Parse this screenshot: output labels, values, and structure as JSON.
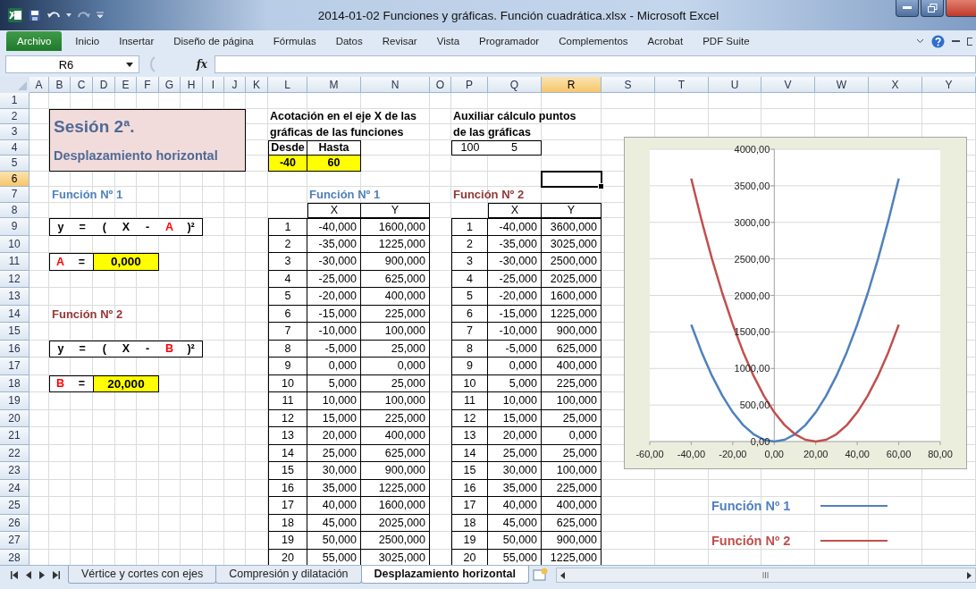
{
  "window": {
    "title": "2014-01-02 Funciones y gráficas. Función cuadrática.xlsx  -  Microsoft Excel"
  },
  "ribbon": {
    "tabs": [
      {
        "label": "Archivo",
        "kind": "file"
      },
      {
        "label": "Inicio",
        "kind": "tab"
      },
      {
        "label": "Insertar",
        "kind": "tab"
      },
      {
        "label": "Diseño de página",
        "kind": "tab"
      },
      {
        "label": "Fórmulas",
        "kind": "tab"
      },
      {
        "label": "Datos",
        "kind": "tab"
      },
      {
        "label": "Revisar",
        "kind": "tab"
      },
      {
        "label": "Vista",
        "kind": "tab"
      },
      {
        "label": "Programador",
        "kind": "tab"
      },
      {
        "label": "Complementos",
        "kind": "tab"
      },
      {
        "label": "Acrobat",
        "kind": "tab"
      },
      {
        "label": "PDF Suite",
        "kind": "tab"
      }
    ]
  },
  "formula_bar": {
    "name_box": "R6",
    "function_label": "fx"
  },
  "columns": [
    {
      "label": "A",
      "selected": false
    },
    {
      "label": "B",
      "selected": false
    },
    {
      "label": "C",
      "selected": false
    },
    {
      "label": "D",
      "selected": false
    },
    {
      "label": "E",
      "selected": false
    },
    {
      "label": "F",
      "selected": false
    },
    {
      "label": "G",
      "selected": false
    },
    {
      "label": "H",
      "selected": false
    },
    {
      "label": "I",
      "selected": false
    },
    {
      "label": "J",
      "selected": false
    },
    {
      "label": "K",
      "selected": false
    },
    {
      "label": "L",
      "selected": false
    },
    {
      "label": "M",
      "selected": false
    },
    {
      "label": "N",
      "selected": false
    },
    {
      "label": "O",
      "selected": false
    },
    {
      "label": "P",
      "selected": false
    },
    {
      "label": "Q",
      "selected": false
    },
    {
      "label": "R",
      "selected": true
    },
    {
      "label": "S",
      "selected": false
    },
    {
      "label": "T",
      "selected": false
    },
    {
      "label": "U",
      "selected": false
    },
    {
      "label": "V",
      "selected": false
    },
    {
      "label": "W",
      "selected": false
    },
    {
      "label": "X",
      "selected": false
    },
    {
      "label": "Y",
      "selected": false
    }
  ],
  "rows": [
    {
      "label": "1",
      "selected": false
    },
    {
      "label": "2",
      "selected": false
    },
    {
      "label": "3",
      "selected": false
    },
    {
      "label": "4",
      "selected": false
    },
    {
      "label": "5",
      "selected": false
    },
    {
      "label": "6",
      "selected": true
    },
    {
      "label": "7",
      "selected": false
    },
    {
      "label": "8",
      "selected": false
    },
    {
      "label": "9",
      "selected": false
    },
    {
      "label": "10",
      "selected": false
    },
    {
      "label": "11",
      "selected": false
    },
    {
      "label": "12",
      "selected": false
    },
    {
      "label": "13",
      "selected": false
    },
    {
      "label": "14",
      "selected": false
    },
    {
      "label": "15",
      "selected": false
    },
    {
      "label": "16",
      "selected": false
    },
    {
      "label": "17",
      "selected": false
    },
    {
      "label": "18",
      "selected": false
    },
    {
      "label": "19",
      "selected": false
    },
    {
      "label": "20",
      "selected": false
    },
    {
      "label": "21",
      "selected": false
    },
    {
      "label": "22",
      "selected": false
    },
    {
      "label": "23",
      "selected": false
    },
    {
      "label": "24",
      "selected": false
    },
    {
      "label": "25",
      "selected": false
    },
    {
      "label": "26",
      "selected": false
    },
    {
      "label": "27",
      "selected": false
    },
    {
      "label": "28",
      "selected": false
    }
  ],
  "sheet": {
    "title_box": {
      "title": "Sesión 2ª.",
      "subtitle": "Desplazamiento horizontal"
    },
    "functions": [
      {
        "heading": "Función Nº 1",
        "color": "#4f81bd",
        "formula": [
          {
            "text": "y",
            "kind": "symbol"
          },
          {
            "text": "=",
            "kind": "symbol"
          },
          {
            "text": "(",
            "kind": "symbol"
          },
          {
            "text": "X",
            "kind": "symbol"
          },
          {
            "text": "-",
            "kind": "symbol"
          },
          {
            "text": "A",
            "kind": "parameter"
          },
          {
            "text": ")²",
            "kind": "symbol"
          }
        ],
        "parameter": {
          "name": "A",
          "sign": "=",
          "value": "0,000"
        }
      },
      {
        "heading": "Función Nº 2",
        "color": "#953735",
        "formula": [
          {
            "text": "y",
            "kind": "symbol"
          },
          {
            "text": "=",
            "kind": "symbol"
          },
          {
            "text": "(",
            "kind": "symbol"
          },
          {
            "text": "X",
            "kind": "symbol"
          },
          {
            "text": "-",
            "kind": "symbol"
          },
          {
            "text": "B",
            "kind": "parameter"
          },
          {
            "text": ")²",
            "kind": "symbol"
          }
        ],
        "parameter": {
          "name": "B",
          "sign": "=",
          "value": "20,000"
        }
      }
    ],
    "x_range": {
      "caption": [
        "Acotación en el eje X de las",
        "gráficas de las funciones"
      ],
      "headers": [
        "Desde",
        "Hasta"
      ],
      "values": [
        "-40",
        "60"
      ]
    },
    "auxiliary": {
      "caption": [
        "Auxiliar cálculo puntos",
        "de las gráficas"
      ],
      "values": [
        "100",
        "5"
      ]
    },
    "tables": [
      {
        "heading": "Función Nº 1",
        "color": "#4f81bd",
        "columns": [
          "",
          "X",
          "Y"
        ],
        "rows": [
          [
            "1",
            "-40,000",
            "1600,000"
          ],
          [
            "2",
            "-35,000",
            "1225,000"
          ],
          [
            "3",
            "-30,000",
            "900,000"
          ],
          [
            "4",
            "-25,000",
            "625,000"
          ],
          [
            "5",
            "-20,000",
            "400,000"
          ],
          [
            "6",
            "-15,000",
            "225,000"
          ],
          [
            "7",
            "-10,000",
            "100,000"
          ],
          [
            "8",
            "-5,000",
            "25,000"
          ],
          [
            "9",
            "0,000",
            "0,000"
          ],
          [
            "10",
            "5,000",
            "25,000"
          ],
          [
            "11",
            "10,000",
            "100,000"
          ],
          [
            "12",
            "15,000",
            "225,000"
          ],
          [
            "13",
            "20,000",
            "400,000"
          ],
          [
            "14",
            "25,000",
            "625,000"
          ],
          [
            "15",
            "30,000",
            "900,000"
          ],
          [
            "16",
            "35,000",
            "1225,000"
          ],
          [
            "17",
            "40,000",
            "1600,000"
          ],
          [
            "18",
            "45,000",
            "2025,000"
          ],
          [
            "19",
            "50,000",
            "2500,000"
          ],
          [
            "20",
            "55,000",
            "3025,000"
          ]
        ]
      },
      {
        "heading": "Función Nº 2",
        "color": "#953735",
        "columns": [
          "",
          "X",
          "Y"
        ],
        "rows": [
          [
            "1",
            "-40,000",
            "3600,000"
          ],
          [
            "2",
            "-35,000",
            "3025,000"
          ],
          [
            "3",
            "-30,000",
            "2500,000"
          ],
          [
            "4",
            "-25,000",
            "2025,000"
          ],
          [
            "5",
            "-20,000",
            "1600,000"
          ],
          [
            "6",
            "-15,000",
            "1225,000"
          ],
          [
            "7",
            "-10,000",
            "900,000"
          ],
          [
            "8",
            "-5,000",
            "625,000"
          ],
          [
            "9",
            "0,000",
            "400,000"
          ],
          [
            "10",
            "5,000",
            "225,000"
          ],
          [
            "11",
            "10,000",
            "100,000"
          ],
          [
            "12",
            "15,000",
            "25,000"
          ],
          [
            "13",
            "20,000",
            "0,000"
          ],
          [
            "14",
            "25,000",
            "25,000"
          ],
          [
            "15",
            "30,000",
            "100,000"
          ],
          [
            "16",
            "35,000",
            "225,000"
          ],
          [
            "17",
            "40,000",
            "400,000"
          ],
          [
            "18",
            "45,000",
            "625,000"
          ],
          [
            "19",
            "50,000",
            "900,000"
          ],
          [
            "20",
            "55,000",
            "1225,000"
          ]
        ]
      }
    ],
    "chart": {
      "chart_data": {
        "type": "line",
        "x": [
          -40,
          -35,
          -30,
          -25,
          -20,
          -15,
          -10,
          -5,
          0,
          5,
          10,
          15,
          20,
          25,
          30,
          35,
          40,
          45,
          50,
          55,
          60
        ],
        "series": [
          {
            "name": "Función Nº 1",
            "color": "#4f81bd",
            "values": [
              1600,
              1225,
              900,
              625,
              400,
              225,
              100,
              25,
              0,
              25,
              100,
              225,
              400,
              625,
              900,
              1225,
              1600,
              2025,
              2500,
              3025,
              3600
            ]
          },
          {
            "name": "Función Nº 2",
            "color": "#c0504d",
            "values": [
              3600,
              3025,
              2500,
              2025,
              1600,
              1225,
              900,
              625,
              400,
              225,
              100,
              25,
              0,
              25,
              100,
              225,
              400,
              625,
              900,
              1225,
              1600
            ]
          }
        ],
        "xlim": [
          -60,
          80
        ],
        "ylim": [
          0,
          4000
        ],
        "grid": true,
        "xticks": [
          {
            "value": -60,
            "label": "-60,00"
          },
          {
            "value": -40,
            "label": "-40,00"
          },
          {
            "value": -20,
            "label": "-20,00"
          },
          {
            "value": 0,
            "label": "0,00"
          },
          {
            "value": 20,
            "label": "20,00"
          },
          {
            "value": 40,
            "label": "40,00"
          },
          {
            "value": 60,
            "label": "60,00"
          },
          {
            "value": 80,
            "label": "80,00"
          }
        ],
        "yticks": [
          {
            "value": 0,
            "label": "0,00"
          },
          {
            "value": 500,
            "label": "500,00"
          },
          {
            "value": 1000,
            "label": "1000,00"
          },
          {
            "value": 1500,
            "label": "1500,00"
          },
          {
            "value": 2000,
            "label": "2000,00"
          },
          {
            "value": 2500,
            "label": "2500,00"
          },
          {
            "value": 3000,
            "label": "3000,00"
          },
          {
            "value": 3500,
            "label": "3500,00"
          },
          {
            "value": 4000,
            "label": "4000,00"
          }
        ]
      }
    }
  },
  "sheet_tabs": [
    {
      "label": "Vértice y cortes con ejes",
      "selected": false
    },
    {
      "label": "Compresión y dilatación",
      "selected": false
    },
    {
      "label": "Desplazamiento horizontal",
      "selected": true
    }
  ]
}
